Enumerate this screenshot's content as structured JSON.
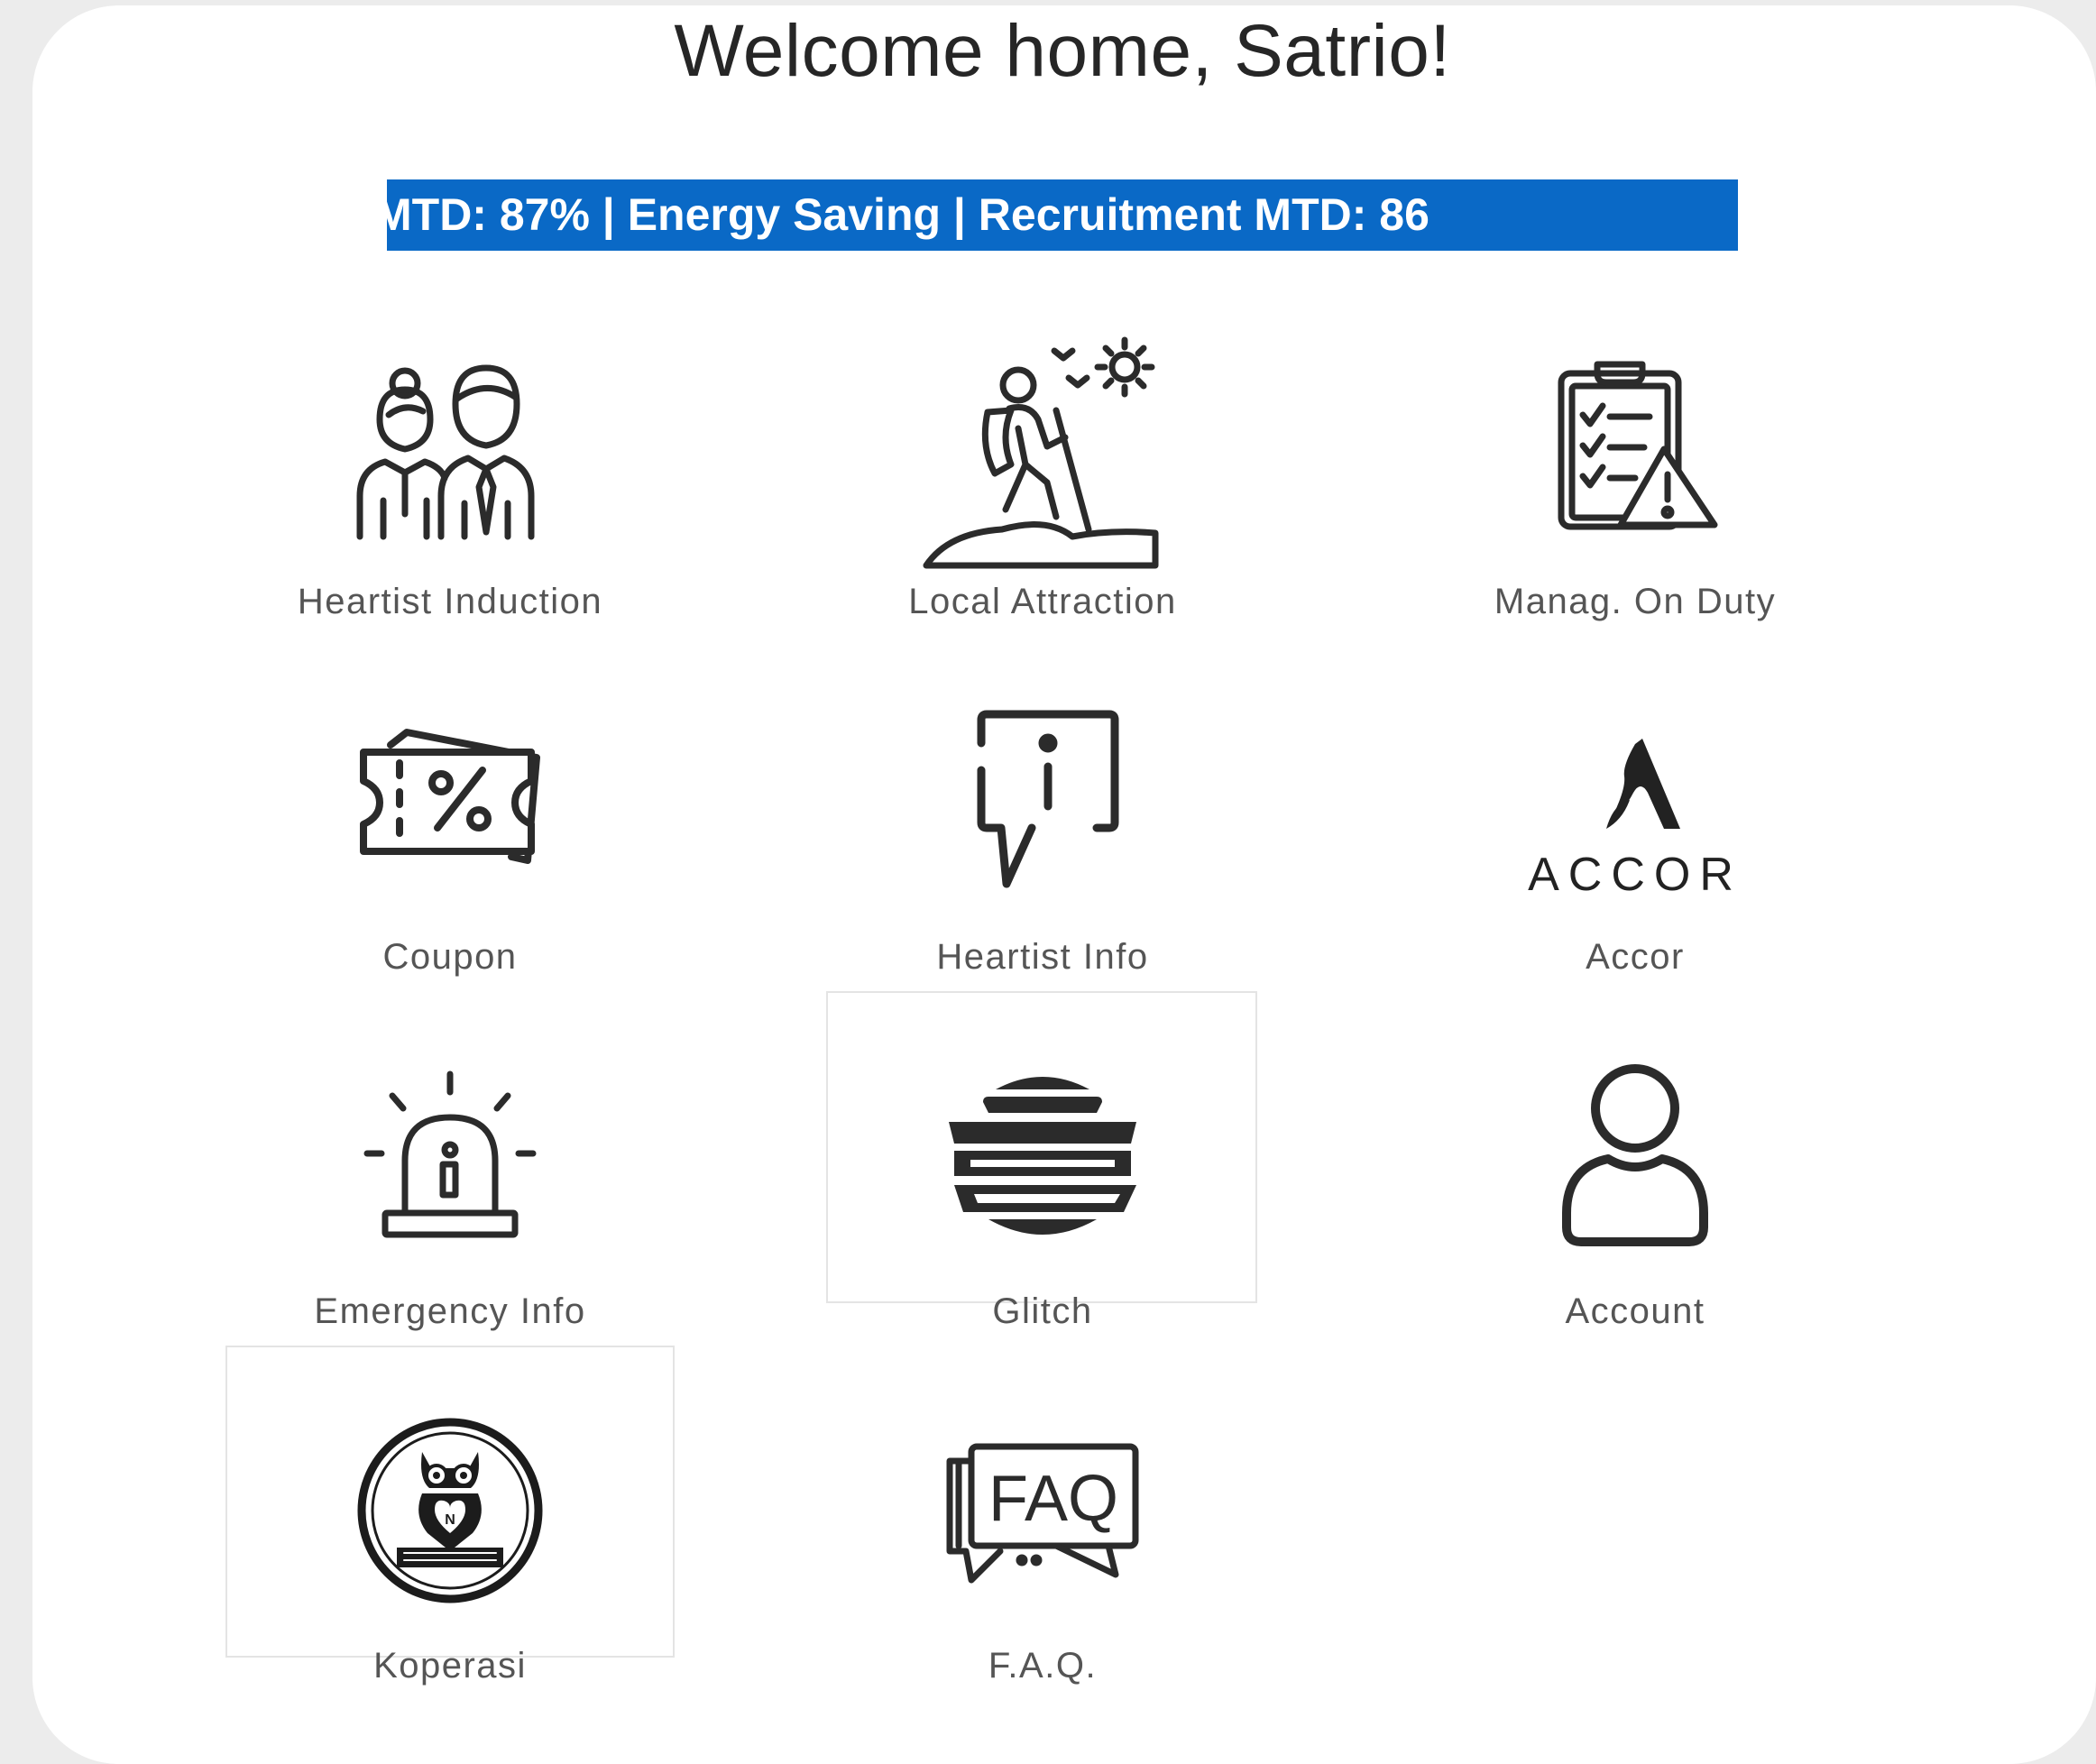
{
  "header": {
    "title": "Welcome home, Satrio!"
  },
  "ticker": {
    "text": "MTD: 87% | Energy Saving | Recruitment MTD: 86",
    "background": "#0a69c6"
  },
  "menu": {
    "items": [
      {
        "label": "Heartist Induction",
        "icon": "people-icon"
      },
      {
        "label": "Local Attraction",
        "icon": "hiker-icon"
      },
      {
        "label": "Manag. On Duty",
        "icon": "clipboard-warning-icon"
      },
      {
        "label": "Coupon",
        "icon": "coupon-icon"
      },
      {
        "label": "Heartist Info",
        "icon": "info-bubble-icon"
      },
      {
        "label": "Accor",
        "icon": "accor-logo",
        "logo_text": "ACCOR"
      },
      {
        "label": "Emergency Info",
        "icon": "alarm-light-icon"
      },
      {
        "label": "Glitch",
        "icon": "glitch-icon"
      },
      {
        "label": "Account",
        "icon": "user-icon"
      },
      {
        "label": "Koperasi",
        "icon": "koperasi-owl-logo"
      },
      {
        "label": "F.A.Q.",
        "icon": "faq-icon"
      }
    ]
  }
}
